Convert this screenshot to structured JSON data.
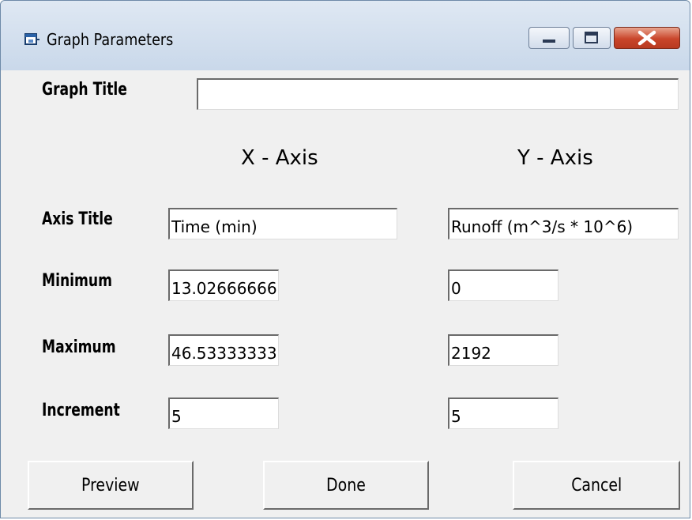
{
  "window": {
    "title": "Graph Parameters",
    "icons": {
      "app": "app-window-icon",
      "minimize": "minimize-icon",
      "maximize": "maximize-icon",
      "close": "close-icon"
    },
    "close_button_color": "#c9452a"
  },
  "graph_title": {
    "label": "Graph Title",
    "value": ""
  },
  "headers": {
    "x_axis": "X - Axis",
    "y_axis": "Y - Axis"
  },
  "rows": {
    "axis_title": {
      "label": "Axis Title",
      "x_value": "Time (min)",
      "y_value": "Runoff (m^3/s * 10^6)"
    },
    "minimum": {
      "label": "Minimum",
      "x_value": "13.02666666",
      "y_value": "0"
    },
    "maximum": {
      "label": "Maximum",
      "x_value": "46.53333333",
      "y_value": "2192"
    },
    "increment": {
      "label": "Increment",
      "x_value": "5",
      "y_value": "5"
    }
  },
  "buttons": {
    "preview": "Preview",
    "done": "Done",
    "cancel": "Cancel"
  }
}
